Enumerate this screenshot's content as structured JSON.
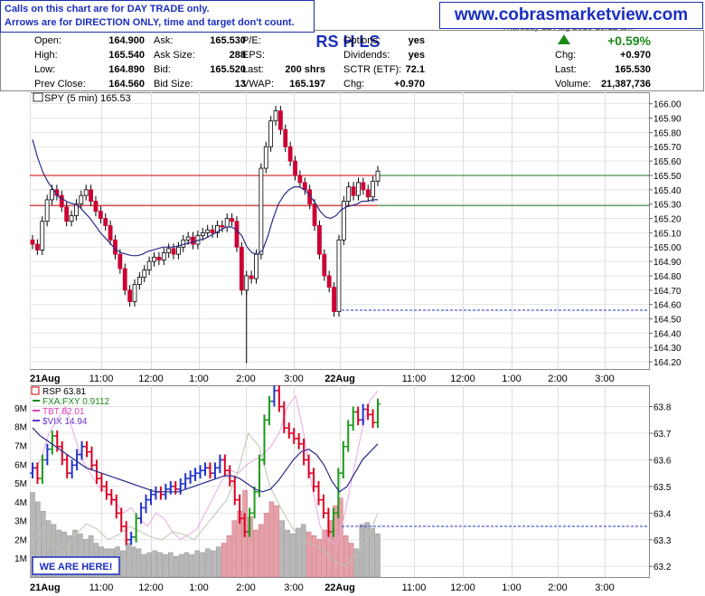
{
  "notes": {
    "line1": "Calls on this chart are for DAY TRADE only.",
    "line2": "Arrows are for DIRECTION ONLY, time and target don't count."
  },
  "website": "www.cobrasmarketview.com",
  "header": {
    "date_partial": "Thursday 22 Aug 2019 10:12 am",
    "signals": "RS H LS",
    "quote": [
      {
        "label": "Open:",
        "value": "164.900"
      },
      {
        "label": "High:",
        "value": "165.540"
      },
      {
        "label": "Low:",
        "value": "164.890"
      },
      {
        "label": "Prev Close:",
        "value": "164.560"
      },
      {
        "label": "Ask:",
        "value": "165.530"
      },
      {
        "label": "Ask Size:",
        "value": "288"
      },
      {
        "label": "Bid:",
        "value": "165.520"
      },
      {
        "label": "Bid Size:",
        "value": "13"
      },
      {
        "label": "P/E:",
        "value": ""
      },
      {
        "label": "EPS:",
        "value": ""
      },
      {
        "label": "Last:",
        "value": "200 shrs"
      },
      {
        "label": "VWAP:",
        "value": "165.197"
      },
      {
        "label": "Options:",
        "value": "yes"
      },
      {
        "label": "Dividends:",
        "value": "yes"
      },
      {
        "label": "SCTR (ETF):",
        "value": "72.1"
      },
      {
        "label": "Chg:",
        "value": "+0.970"
      },
      {
        "label": "Last:",
        "value": "165.530"
      },
      {
        "label": "Volume:",
        "value": "21,387,736"
      }
    ],
    "pct_change": "+0.59%",
    "colors": {
      "up": "#1a8a1a",
      "text_blue": "#1a2fbf"
    }
  },
  "chart_data": [
    {
      "type": "candlestick",
      "title": "SPY (5 min) 165.53",
      "x_ticks": [
        "21Aug",
        "11:00",
        "12:00",
        "1:00",
        "2:00",
        "3:00",
        "22Aug",
        "11:00",
        "12:00",
        "1:00",
        "2:00",
        "3:00"
      ],
      "y_ticks": [
        "166.00",
        "165.90",
        "165.80",
        "165.70",
        "165.60",
        "165.50",
        "165.40",
        "165.30",
        "165.20",
        "165.10",
        "165.00",
        "164.90",
        "164.80",
        "164.70",
        "164.60",
        "164.50",
        "164.40",
        "164.30",
        "164.20"
      ],
      "ylim": [
        164.15,
        166.08
      ],
      "horizontal_lines": [
        {
          "value": 165.5,
          "color": "#cc0000",
          "segment": "left"
        },
        {
          "value": 165.29,
          "color": "#cc0000",
          "segment": "left"
        },
        {
          "value": 165.5,
          "color": "#1a7a1a",
          "segment": "right"
        },
        {
          "value": 165.29,
          "color": "#1a7a1a",
          "segment": "right"
        },
        {
          "value": 164.56,
          "color": "#2233cc",
          "style": "dashed",
          "segment": "right"
        }
      ],
      "closes": [
        165.02,
        164.98,
        165.18,
        165.33,
        165.4,
        165.36,
        165.28,
        165.18,
        165.22,
        165.3,
        165.36,
        165.4,
        165.32,
        165.25,
        165.2,
        165.15,
        165.05,
        164.95,
        164.85,
        164.7,
        164.62,
        164.74,
        164.79,
        164.84,
        164.9,
        164.93,
        164.91,
        164.96,
        164.99,
        164.95,
        165.0,
        165.05,
        165.07,
        165.02,
        165.08,
        165.1,
        165.12,
        165.1,
        165.15,
        165.14,
        165.2,
        165.18,
        165.0,
        164.7,
        164.8,
        164.78,
        164.95,
        165.55,
        165.7,
        165.88,
        165.95,
        165.82,
        165.7,
        165.6,
        165.5,
        165.45,
        165.4,
        165.3,
        165.15,
        164.95,
        164.8,
        164.72,
        164.55,
        165.05,
        165.32,
        165.42,
        165.36,
        165.45,
        165.4,
        165.35,
        165.46,
        165.53
      ],
      "vwap_line": [
        165.75,
        165.62,
        165.52,
        165.45,
        165.4,
        165.35,
        165.33,
        165.31,
        165.3,
        165.28,
        165.24,
        165.2,
        165.15,
        165.1,
        165.06,
        165.02,
        164.98,
        164.96,
        164.95,
        164.94,
        164.94,
        164.95,
        164.97,
        164.98,
        164.99,
        165.0,
        165.0,
        165.0,
        165.01,
        165.02,
        165.03,
        165.04,
        165.05,
        165.06,
        165.08,
        165.1,
        165.12,
        165.14,
        165.14,
        165.12,
        165.08,
        165.0,
        164.96,
        164.95,
        164.98,
        165.08,
        165.2,
        165.3,
        165.36,
        165.4,
        165.42,
        165.42,
        165.4,
        165.36,
        165.31,
        165.25,
        165.21,
        165.2,
        165.22,
        165.26,
        165.28,
        165.29,
        165.3,
        165.32,
        165.32,
        165.33,
        165.33
      ]
    },
    {
      "type": "line",
      "title": "RSP 63.81",
      "legend": [
        {
          "name": "FXA:FXY 0.9112",
          "color": "#1a8a1a"
        },
        {
          "name": "TBT 82.01",
          "color": "#e040c0"
        },
        {
          "name": "$VIX 14.94",
          "color": "#6633cc"
        }
      ],
      "y_ticks_right": [
        "63.8",
        "63.7",
        "63.6",
        "63.5",
        "63.4",
        "63.3",
        "63.2"
      ],
      "y_ticks_left": [
        "9M",
        "8M",
        "7M",
        "6M",
        "5M",
        "4M",
        "3M",
        "2M",
        "1M"
      ],
      "ylim": [
        63.16,
        63.88
      ],
      "dashed_line_value": 63.35,
      "annotation": "WE ARE HERE!",
      "closes": [
        63.57,
        63.53,
        63.6,
        63.64,
        63.69,
        63.65,
        63.6,
        63.55,
        63.58,
        63.62,
        63.65,
        63.63,
        63.58,
        63.53,
        63.5,
        63.47,
        63.45,
        63.4,
        63.35,
        63.3,
        63.31,
        63.38,
        63.42,
        63.45,
        63.47,
        63.48,
        63.47,
        63.49,
        63.5,
        63.49,
        63.51,
        63.53,
        63.54,
        63.55,
        63.56,
        63.57,
        63.55,
        63.57,
        63.6,
        63.56,
        63.52,
        63.45,
        63.38,
        63.33,
        63.4,
        63.48,
        63.6,
        63.75,
        63.82,
        63.86,
        63.8,
        63.72,
        63.7,
        63.68,
        63.66,
        63.6,
        63.55,
        63.5,
        63.45,
        63.4,
        63.33,
        63.4,
        63.55,
        63.65,
        63.73,
        63.78,
        63.75,
        63.79,
        63.77,
        63.74,
        63.81
      ],
      "ma_line": [
        63.72,
        63.69,
        63.67,
        63.65,
        63.63,
        63.61,
        63.59,
        63.57,
        63.56,
        63.55,
        63.54,
        63.53,
        63.52,
        63.51,
        63.5,
        63.49,
        63.48,
        63.48,
        63.48,
        63.48,
        63.49,
        63.5,
        63.51,
        63.52,
        63.53,
        63.54,
        63.54,
        63.53,
        63.51,
        63.49,
        63.48,
        63.49,
        63.52,
        63.56,
        63.6,
        63.63,
        63.64,
        63.62,
        63.58,
        63.52,
        63.48,
        63.5,
        63.55,
        63.6,
        63.63,
        63.66
      ],
      "volume_millions": [
        4.5,
        4.0,
        3.5,
        3.0,
        2.8,
        2.5,
        2.4,
        2.2,
        2.5,
        2.3,
        2.0,
        2.2,
        1.8,
        1.6,
        1.5,
        1.5,
        1.6,
        1.4,
        1.8,
        1.6,
        1.5,
        1.2,
        1.3,
        1.4,
        1.3,
        1.2,
        1.3,
        1.1,
        1.2,
        1.3,
        1.2,
        1.4,
        1.3,
        1.5,
        1.4,
        1.6,
        1.8,
        2.2,
        3.0,
        3.5,
        4.6,
        3.2,
        2.5,
        2.8,
        3.4,
        4.0,
        3.8,
        3.0,
        2.5,
        2.3,
        2.6,
        2.8,
        2.4,
        2.2,
        2.0,
        2.5,
        3.0,
        3.8,
        4.2,
        2.2,
        1.8,
        1.5,
        2.8,
        2.9,
        2.6,
        2.3
      ]
    }
  ]
}
